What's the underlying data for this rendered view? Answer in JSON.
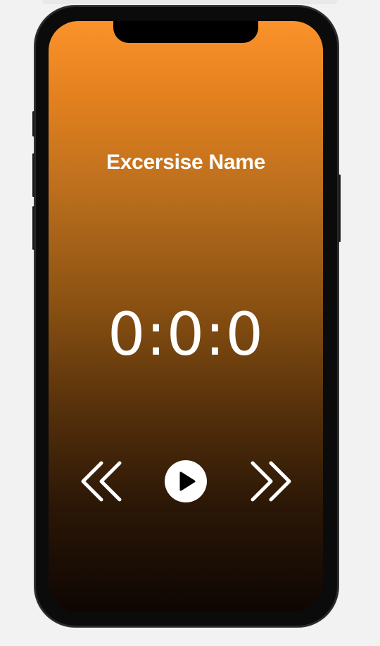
{
  "exercise": {
    "name": "Excersise Name"
  },
  "timer": {
    "display": "0:0:0"
  },
  "controls": {
    "previous_icon": "double-chevron-left-icon",
    "play_icon": "play-circle-icon",
    "next_icon": "double-chevron-right-icon"
  },
  "colors": {
    "gradient_top": "#fb922b",
    "gradient_bottom": "#0e0603",
    "text": "#ffffff",
    "page_background": "#f2f2f2"
  }
}
